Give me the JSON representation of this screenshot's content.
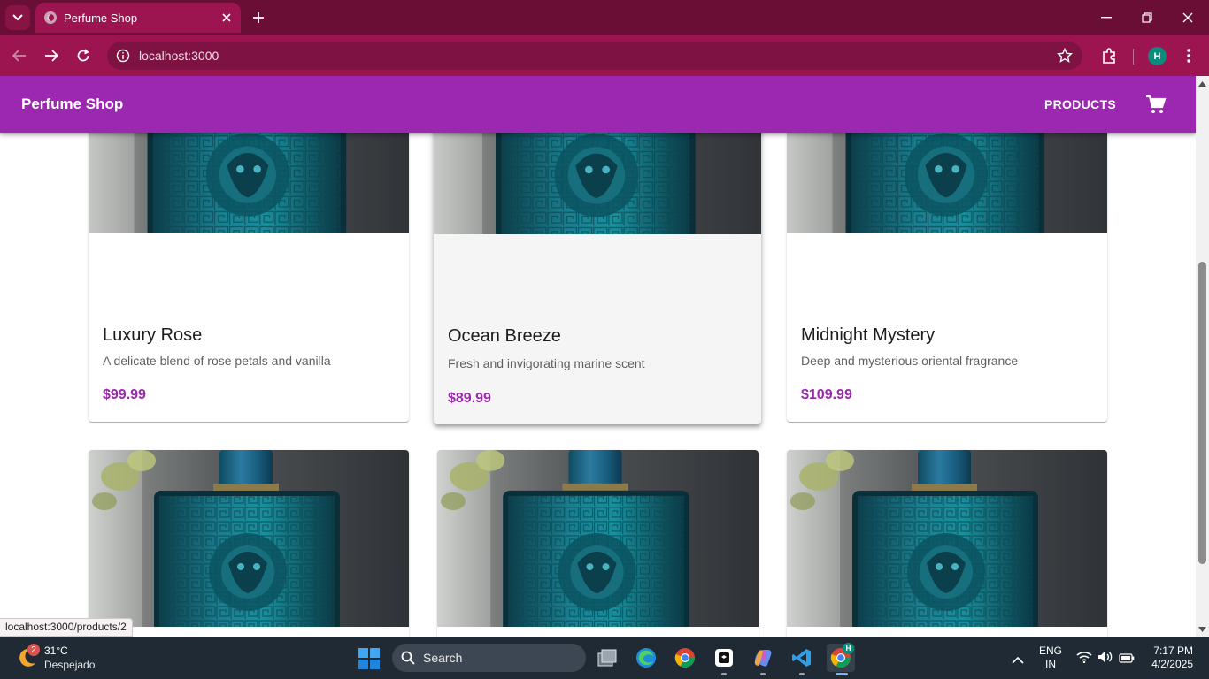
{
  "browser": {
    "tab_title": "Perfume Shop",
    "url": "localhost:3000",
    "profile_initial": "H",
    "status_url": "localhost:3000/products/2"
  },
  "app": {
    "brand": "Perfume Shop",
    "nav_products": "PRODUCTS",
    "accent_color": "#9c27b0"
  },
  "products": [
    {
      "name": "Luxury Rose",
      "description": "A delicate blend of rose petals and vanilla",
      "price": "$99.99"
    },
    {
      "name": "Ocean Breeze",
      "description": "Fresh and invigorating marine scent",
      "price": "$89.99"
    },
    {
      "name": "Midnight Mystery",
      "description": "Deep and mysterious oriental fragrance",
      "price": "$109.99"
    }
  ],
  "taskbar": {
    "weather_badge": "2",
    "weather_temp": "31°C",
    "weather_condition": "Despejado",
    "search_label": "Search",
    "lang_line1": "ENG",
    "lang_line2": "IN",
    "time": "7:17 PM",
    "date": "4/2/2025",
    "copilot_badge": "H"
  }
}
